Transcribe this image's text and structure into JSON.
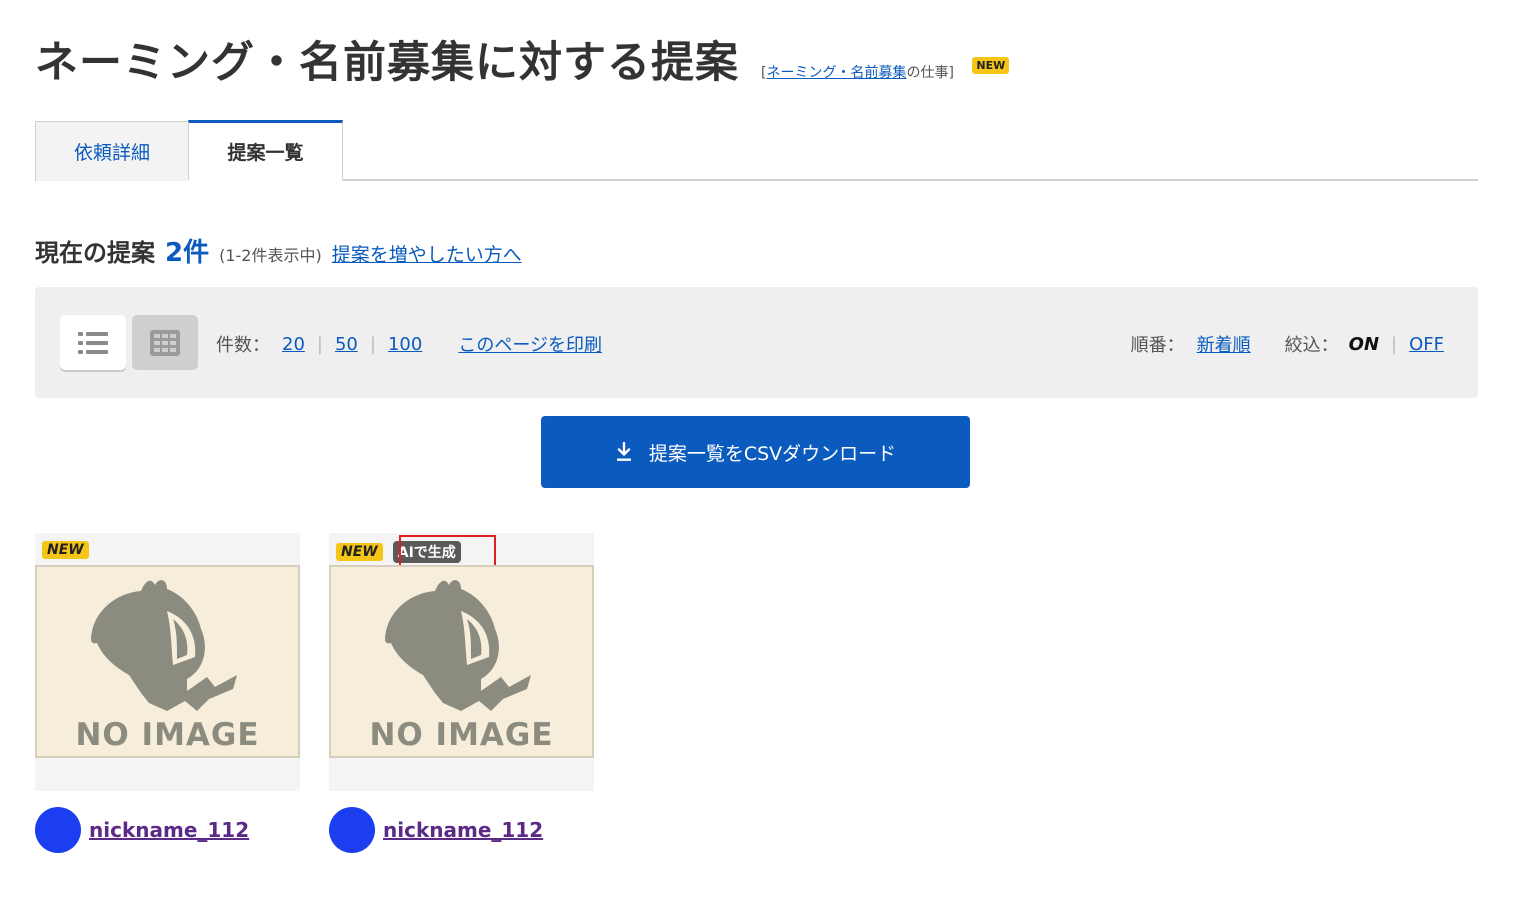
{
  "header": {
    "title": "ネーミング・名前募集に対する提案",
    "category_open": "[",
    "category_link": "ネーミング・名前募集",
    "category_suffix": "の仕事]",
    "new_badge": "NEW"
  },
  "tabs": [
    {
      "label": "依頼詳細",
      "active": false
    },
    {
      "label": "提案一覧",
      "active": true
    }
  ],
  "summary": {
    "label": "現在の提案",
    "count": "2件",
    "range": "(1-2件表示中)",
    "increase_link": "提案を増やしたい方へ"
  },
  "toolbar": {
    "count_label": "件数：",
    "count_options": [
      "20",
      "50",
      "100"
    ],
    "print_link": "このページを印刷",
    "sort_label": "順番：",
    "sort_value": "新着順",
    "filter_label": "絞込：",
    "filter_on": "ON",
    "filter_off": "OFF",
    "view_modes": [
      "list-icon",
      "grid-icon"
    ],
    "active_view": "list"
  },
  "csv_button": {
    "label": "提案一覧をCSVダウンロード",
    "icon": "download-icon"
  },
  "cards": [
    {
      "badges": [
        "NEW"
      ],
      "image_text": "NO IMAGE",
      "author": "nickname_112",
      "avatar_color": "#1a3ef0"
    },
    {
      "badges": [
        "NEW",
        "AIで生成"
      ],
      "image_text": "NO IMAGE",
      "author": "nickname_112",
      "avatar_color": "#1a3ef0"
    }
  ],
  "colors": {
    "accent": "#0b5bbf",
    "badge_yellow": "#f5c518",
    "ai_badge": "#5a5a5a",
    "highlight_red": "#e02020",
    "author_link": "#5b2a86"
  }
}
